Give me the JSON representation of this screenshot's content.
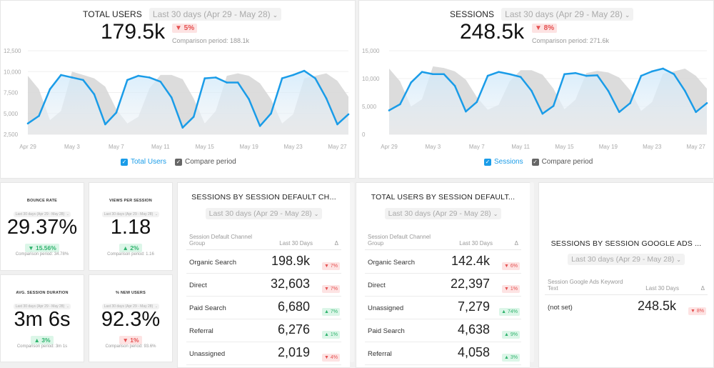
{
  "colors": {
    "accent": "#1a9ce8",
    "compare": "#d9d9d9",
    "down": "#e55050",
    "up": "#2fb36d"
  },
  "users_widget": {
    "title": "TOTAL USERS",
    "date_range": "Last 30 days (Apr 29 - May 28)",
    "value": "179.5k",
    "delta": "▼ 5%",
    "comparison": "Comparison period: 188.1k",
    "legend": {
      "primary": "Total Users",
      "compare": "Compare period"
    }
  },
  "sessions_widget": {
    "title": "SESSIONS",
    "date_range": "Last 30 days (Apr 29 - May 28)",
    "value": "248.5k",
    "delta": "▼ 8%",
    "comparison": "Comparison period: 271.6k",
    "legend": {
      "primary": "Sessions",
      "compare": "Compare period"
    }
  },
  "chart_data": [
    {
      "type": "area",
      "title": "Total Users",
      "x": [
        "Apr 29",
        "Apr 30",
        "May 1",
        "May 2",
        "May 3",
        "May 4",
        "May 5",
        "May 6",
        "May 7",
        "May 8",
        "May 9",
        "May 10",
        "May 11",
        "May 12",
        "May 13",
        "May 14",
        "May 15",
        "May 16",
        "May 17",
        "May 18",
        "May 19",
        "May 20",
        "May 21",
        "May 22",
        "May 23",
        "May 24",
        "May 25",
        "May 26",
        "May 27",
        "May 28"
      ],
      "xticks": [
        "Apr 29",
        "May 3",
        "May 7",
        "May 11",
        "May 15",
        "May 19",
        "May 23",
        "May 27"
      ],
      "yticks": [
        "2,500",
        "5,000",
        "7,500",
        "10,000",
        "12,500"
      ],
      "ylim": [
        2500,
        12500
      ],
      "series": [
        {
          "name": "Total Users",
          "values": [
            3800,
            4700,
            7900,
            9600,
            9300,
            9000,
            7300,
            3700,
            5100,
            9000,
            9500,
            9300,
            8800,
            6900,
            3300,
            4600,
            9200,
            9300,
            8700,
            8700,
            6700,
            3500,
            5000,
            9200,
            9600,
            10100,
            9200,
            6800,
            3700,
            4900
          ]
        },
        {
          "name": "Compare period",
          "values": [
            9500,
            7900,
            4200,
            5300,
            10000,
            9600,
            9200,
            8200,
            5500,
            3800,
            4600,
            8000,
            9600,
            9600,
            9100,
            6800,
            3800,
            5300,
            9500,
            9800,
            9500,
            8600,
            6700,
            3800,
            4900,
            9200,
            9500,
            9800,
            8900,
            7000
          ]
        }
      ]
    },
    {
      "type": "area",
      "title": "Sessions",
      "x": [
        "Apr 29",
        "Apr 30",
        "May 1",
        "May 2",
        "May 3",
        "May 4",
        "May 5",
        "May 6",
        "May 7",
        "May 8",
        "May 9",
        "May 10",
        "May 11",
        "May 12",
        "May 13",
        "May 14",
        "May 15",
        "May 16",
        "May 17",
        "May 18",
        "May 19",
        "May 20",
        "May 21",
        "May 22",
        "May 23",
        "May 24",
        "May 25",
        "May 26",
        "May 27",
        "May 28"
      ],
      "xticks": [
        "Apr 29",
        "May 3",
        "May 7",
        "May 11",
        "May 15",
        "May 19",
        "May 23",
        "May 27"
      ],
      "yticks": [
        "0",
        "5,000",
        "10,000",
        "15,000"
      ],
      "ylim": [
        0,
        15000
      ],
      "series": [
        {
          "name": "Sessions",
          "values": [
            4300,
            5400,
            9300,
            11200,
            10800,
            10800,
            8700,
            4100,
            5800,
            10500,
            11200,
            10800,
            10300,
            7800,
            3700,
            5100,
            10800,
            11000,
            10500,
            10600,
            7800,
            4000,
            5600,
            10500,
            11300,
            11800,
            10800,
            7800,
            4000,
            5600
          ]
        },
        {
          "name": "Compare period",
          "values": [
            11800,
            9500,
            5000,
            6300,
            12200,
            11900,
            11300,
            9800,
            6700,
            4400,
            5300,
            9500,
            11500,
            11500,
            10700,
            8200,
            4500,
            6200,
            11000,
            11400,
            11100,
            10200,
            7900,
            4200,
            5800,
            10900,
            11300,
            11800,
            10500,
            8200
          ]
        }
      ]
    }
  ],
  "kpis": [
    {
      "title": "BOUNCE RATE",
      "date_range": "Last 30 days (Apr 29 - May 28)",
      "value": "29.37%",
      "delta": "▼ 15.56%",
      "delta_type": "good-down",
      "comparison": "Comparison period: 34.78%"
    },
    {
      "title": "VIEWS PER SESSION",
      "date_range": "Last 30 days (Apr 29 - May 28)",
      "value": "1.18",
      "delta": "▲ 2%",
      "delta_type": "up",
      "comparison": "Comparison period: 1.16"
    },
    {
      "title": "AVG. SESSION DURATION",
      "date_range": "Last 30 days (Apr 29 - May 28)",
      "value": "3m 6s",
      "delta": "▲ 3%",
      "delta_type": "up",
      "comparison": "Comparison period: 3m 1s"
    },
    {
      "title": "% NEW USERS",
      "date_range": "Last 30 days (Apr 29 - May 28)",
      "value": "92.3%",
      "delta": "▼ 1%",
      "delta_type": "down",
      "comparison": "Comparison period: 93.6%"
    }
  ],
  "tables": [
    {
      "title": "SESSIONS BY SESSION DEFAULT CH...",
      "date_range": "Last 30 days (Apr 29 - May 28)",
      "headers": [
        "Session Default Channel Group",
        "Last 30 Days",
        "Δ"
      ],
      "rows": [
        {
          "label": "Organic Search",
          "value": "198.9k",
          "delta": "▼ 7%",
          "dir": "down"
        },
        {
          "label": "Direct",
          "value": "32,603",
          "delta": "▼ 7%",
          "dir": "down"
        },
        {
          "label": "Paid Search",
          "value": "6,680",
          "delta": "▲ 7%",
          "dir": "up"
        },
        {
          "label": "Referral",
          "value": "6,276",
          "delta": "▲ 1%",
          "dir": "up"
        },
        {
          "label": "Unassigned",
          "value": "2,019",
          "delta": "▼ 4%",
          "dir": "down"
        }
      ]
    },
    {
      "title": "TOTAL USERS BY SESSION DEFAULT...",
      "date_range": "Last 30 days (Apr 29 - May 28)",
      "headers": [
        "Session Default Channel Group",
        "Last 30 Days",
        "Δ"
      ],
      "rows": [
        {
          "label": "Organic Search",
          "value": "142.4k",
          "delta": "▼ 6%",
          "dir": "down"
        },
        {
          "label": "Direct",
          "value": "22,397",
          "delta": "▼ 1%",
          "dir": "down"
        },
        {
          "label": "Unassigned",
          "value": "7,279",
          "delta": "▲ 74%",
          "dir": "up"
        },
        {
          "label": "Paid Search",
          "value": "4,638",
          "delta": "▲ 9%",
          "dir": "up"
        },
        {
          "label": "Referral",
          "value": "4,058",
          "delta": "▲ 3%",
          "dir": "up"
        }
      ]
    },
    {
      "title": "SESSIONS BY SESSION GOOGLE ADS ...",
      "date_range": "Last 30 days (Apr 29 - May 28)",
      "headers": [
        "Session Google Ads Keyword Text",
        "Last 30 Days",
        "Δ"
      ],
      "rows": [
        {
          "label": "(not set)",
          "value": "248.5k",
          "delta": "▼ 8%",
          "dir": "down"
        }
      ]
    }
  ]
}
